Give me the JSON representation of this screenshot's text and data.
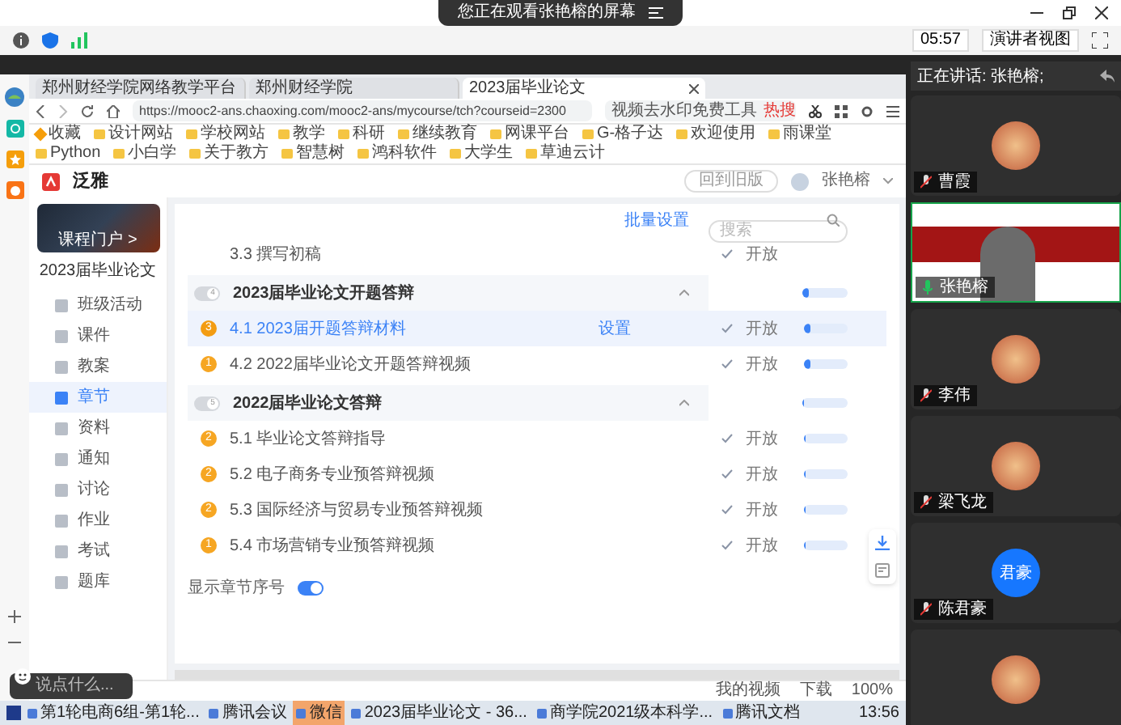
{
  "meeting_banner": {
    "text": "您正在观看张艳榕的屏幕"
  },
  "toolbar": {
    "timer": "05:57",
    "view_button": "演讲者视图"
  },
  "speaking": {
    "text": "正在讲话: 张艳榕;"
  },
  "browser": {
    "tabs": [
      {
        "label": "郑州财经学院网络教学平台",
        "selected": false
      },
      {
        "label": "郑州财经学院",
        "selected": false
      },
      {
        "label": "2023届毕业论文",
        "selected": true
      }
    ],
    "url": "https://mooc2-ans.chaoxing.com/mooc2-ans/mycourse/tch?courseid=2300",
    "search": {
      "value": "视频去水印免费工具",
      "badge": "热搜"
    },
    "bookmarks": [
      "收藏",
      "设计网站",
      "学校网站",
      "教学",
      "科研",
      "继续教育",
      "网课平台",
      "G-格子达",
      "欢迎使用",
      "雨课堂",
      "Python",
      "小白学",
      "关于教方",
      "智慧树",
      "鸿科软件",
      "大学生",
      "草迪云计"
    ],
    "status_bar": [
      "我的视频",
      "下载",
      "100%"
    ]
  },
  "app": {
    "logo": "泛雅",
    "old_version_button": "回到旧版",
    "user": "张艳榕",
    "course": {
      "portal_link": "课程门户 >",
      "title": "2023届毕业论文"
    },
    "menu": [
      {
        "label": "班级活动",
        "selected": false
      },
      {
        "label": "课件",
        "selected": false
      },
      {
        "label": "教案",
        "selected": false
      },
      {
        "label": "章节",
        "selected": true
      },
      {
        "label": "资料",
        "selected": false
      },
      {
        "label": "通知",
        "selected": false
      },
      {
        "label": "讨论",
        "selected": false
      },
      {
        "label": "作业",
        "selected": false
      },
      {
        "label": "考试",
        "selected": false
      },
      {
        "label": "题库",
        "selected": false
      }
    ],
    "batch_link": "批量设置",
    "search_placeholder": "搜索",
    "chapters": [
      {
        "kind": "item",
        "title": "3.3 撰写初稿",
        "status": "开放",
        "selected": false
      },
      {
        "kind": "section",
        "number": "4",
        "title": "2023届毕业论文开题答辩",
        "expanded": true,
        "level": 0.15
      },
      {
        "kind": "item",
        "badge": "3",
        "title": "4.1 2023届开题答辩材料",
        "action": "设置",
        "status": "开放",
        "level": 0.15,
        "selected": true
      },
      {
        "kind": "item",
        "badge": "1",
        "title": "4.2 2022届毕业论文开题答辩视频",
        "status": "开放",
        "level": 0.15,
        "selected": false
      },
      {
        "kind": "section",
        "number": "5",
        "title": "2022届毕业论文答辩",
        "expanded": true,
        "level": 0.03
      },
      {
        "kind": "item",
        "badge": "2",
        "title": "5.1 毕业论文答辩指导",
        "status": "开放",
        "level": 0.03,
        "selected": false
      },
      {
        "kind": "item",
        "badge": "2",
        "title": "5.2 电子商务专业预答辩视频",
        "status": "开放",
        "level": 0.03,
        "selected": false
      },
      {
        "kind": "item",
        "badge": "2",
        "title": "5.3 国际经济与贸易专业预答辩视频",
        "status": "开放",
        "level": 0.03,
        "selected": false
      },
      {
        "kind": "item",
        "badge": "1",
        "title": "5.4 市场营销专业预答辩视频",
        "status": "开放",
        "level": 0.03,
        "selected": false
      }
    ],
    "show_numbers": {
      "label": "显示章节序号",
      "on": true
    }
  },
  "chat": {
    "placeholder": "说点什么..."
  },
  "participants": [
    {
      "kind": "avatar",
      "name": "曹霞",
      "muted": true
    },
    {
      "kind": "video",
      "name": "张艳榕",
      "muted": false
    },
    {
      "kind": "avatar",
      "name": "李伟",
      "muted": true
    },
    {
      "kind": "avatar",
      "name": "梁飞龙",
      "muted": true
    },
    {
      "kind": "initials",
      "initials": "君豪",
      "name": "陈君豪",
      "muted": true
    },
    {
      "kind": "avatar"
    }
  ],
  "taskbar": {
    "items": [
      {
        "label": "第1轮电商6组-第1轮...",
        "selected": false
      },
      {
        "label": "腾讯会议",
        "selected": false
      },
      {
        "label": "微信",
        "selected": true
      },
      {
        "label": "2023届毕业论文 - 36...",
        "selected": false
      },
      {
        "label": "商学院2021级本科学...",
        "selected": false
      },
      {
        "label": "腾讯文档",
        "selected": false
      }
    ],
    "clock": "13:56"
  }
}
